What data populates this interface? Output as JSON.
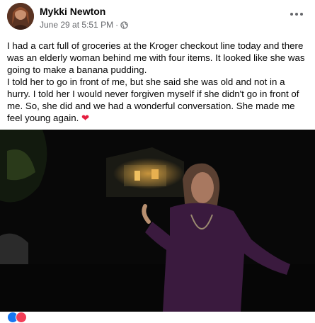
{
  "post": {
    "author": "Mykki Newton",
    "date": "June 29 at 5:51 PM",
    "separator": "·",
    "text_lines": [
      "I had a cart full of groceries at the Kroger checkout line today and there was an elderly woman behind me with four items. It looked like she was going to make a banana pudding.",
      "I told her to go in front of me, but she said she was old and not in a hurry. I told her I would never forgiven myself if she didn't go in front of me. So, she did and we had a wonderful conversation. She made me feel young again."
    ],
    "emoji": "❤"
  },
  "icons": {
    "privacy": "globe-icon",
    "menu": "more-options-icon"
  },
  "colors": {
    "text": "#050505",
    "meta": "#65676b",
    "heart": "#e41e3f",
    "like": "#1877f2"
  }
}
